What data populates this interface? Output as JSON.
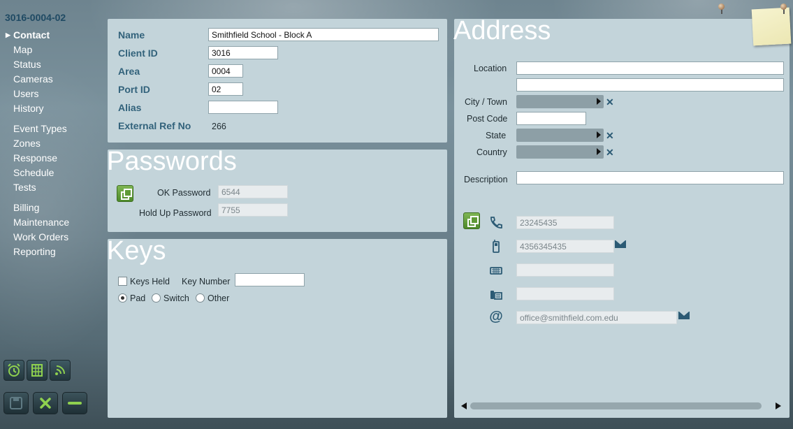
{
  "record_id": "3016-0004-02",
  "nav": {
    "groups": [
      [
        {
          "label": "Contact",
          "active": true
        },
        {
          "label": "Map"
        },
        {
          "label": "Status"
        },
        {
          "label": "Cameras"
        },
        {
          "label": "Users"
        },
        {
          "label": "History"
        }
      ],
      [
        {
          "label": "Event Types"
        },
        {
          "label": "Zones"
        },
        {
          "label": "Response"
        },
        {
          "label": "Schedule"
        },
        {
          "label": "Tests"
        }
      ],
      [
        {
          "label": "Billing"
        },
        {
          "label": "Maintenance"
        },
        {
          "label": "Work Orders"
        },
        {
          "label": "Reporting"
        }
      ]
    ]
  },
  "contact": {
    "name_label": "Name",
    "name_value": "Smithfield School - Block A",
    "client_id_label": "Client ID",
    "client_id_value": "3016",
    "area_label": "Area",
    "area_value": "0004",
    "port_id_label": "Port ID",
    "port_id_value": "02",
    "alias_label": "Alias",
    "alias_value": "",
    "external_ref_label": "External Ref No",
    "external_ref_value": "266"
  },
  "passwords": {
    "title": "Passwords",
    "ok_label": "OK Password",
    "ok_value": "6544",
    "holdup_label": "Hold Up Password",
    "holdup_value": "7755"
  },
  "keys": {
    "title": "Keys",
    "keys_held_label": "Keys Held",
    "keys_held_checked": false,
    "key_number_label": "Key Number",
    "key_number_value": "",
    "radio_options": [
      "Pad",
      "Switch",
      "Other"
    ],
    "radio_selected": "Pad"
  },
  "address": {
    "title": "Address",
    "location_label": "Location",
    "location_line1": "",
    "location_line2": "",
    "city_label": "City / Town",
    "postcode_label": "Post Code",
    "postcode_value": "",
    "state_label": "State",
    "country_label": "Country",
    "description_label": "Description",
    "description_value": "",
    "phone_value": "23245435",
    "mobile_value": "4356345435",
    "fax_value": "",
    "other_phone_value": "",
    "email_value": "office@smithfield.com.edu"
  },
  "colors": {
    "panel_bg": "#c3d4da",
    "label_blue": "#32627b",
    "accent_green": "#5f9a36",
    "icon_blue": "#2b5a74"
  }
}
